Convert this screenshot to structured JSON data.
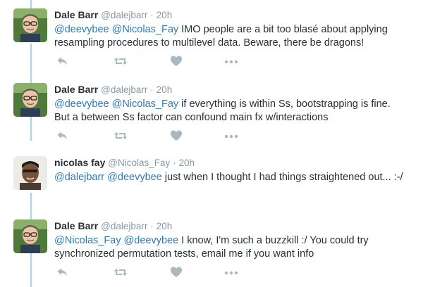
{
  "tweets": [
    {
      "fullname": "Dale Barr",
      "handle": "@dalejbarr",
      "sep": "·",
      "time": "20h",
      "mentions": [
        "@deevybee",
        "@Nicolas_Fay"
      ],
      "text": " IMO people are a bit too blasé about applying resampling procedures to multilevel data. Beware, there be dragons!"
    },
    {
      "fullname": "Dale Barr",
      "handle": "@dalejbarr",
      "sep": "·",
      "time": "20h",
      "mentions": [
        "@deevybee",
        "@Nicolas_Fay"
      ],
      "text": " if everything is within Ss, bootstrapping is fine. But a between Ss factor can confound main fx w/interactions"
    },
    {
      "fullname": "nicolas fay",
      "handle": "@Nicolas_Fay",
      "sep": "·",
      "time": "20h",
      "mentions": [
        "@dalejbarr",
        "@deevybee"
      ],
      "text": " just when I thought I had things straightened out... :-/"
    },
    {
      "fullname": "Dale Barr",
      "handle": "@dalejbarr",
      "sep": "·",
      "time": "20h",
      "mentions": [
        "@Nicolas_Fay",
        "@deevybee"
      ],
      "text": " I know, I'm such a buzzkill :/ You could try synchronized permutation tests, email me if you want info"
    }
  ],
  "icons": {
    "reply": "reply-icon",
    "retweet": "retweet-icon",
    "like": "heart-icon",
    "more": "more-icon"
  },
  "colors": {
    "mention": "#2b7bb9",
    "meta": "#8899a6",
    "icon": "#aab8c2",
    "thread_line": "#a6d6ee"
  }
}
